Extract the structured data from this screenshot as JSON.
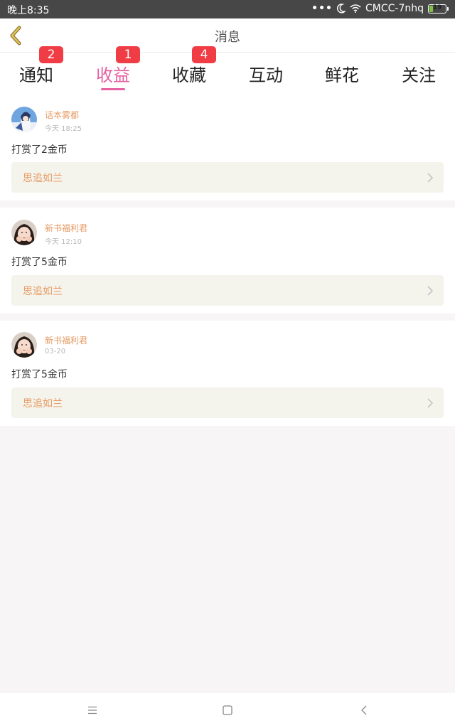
{
  "status_bar": {
    "time": "晚上8:35",
    "dots": "•••",
    "carrier": "CMCC-7nhq",
    "battery_level": "19",
    "battery_fraction": 0.19
  },
  "header": {
    "title": "消息",
    "back_icon": "chevron-left-icon",
    "back_color": "#c9a43a"
  },
  "tabs": [
    {
      "label": "通知",
      "badge": "2",
      "active": false
    },
    {
      "label": "收益",
      "badge": "1",
      "active": true
    },
    {
      "label": "收藏",
      "badge": "4",
      "active": false
    },
    {
      "label": "互动",
      "badge": "",
      "active": false
    },
    {
      "label": "鲜花",
      "badge": "",
      "active": false
    },
    {
      "label": "关注",
      "badge": "",
      "active": false
    }
  ],
  "colors": {
    "accent": "#e660a1",
    "badge": "#f03c45",
    "name": "#e59b66",
    "book_bg": "#f5f4ec"
  },
  "messages": [
    {
      "user": "话本雾都",
      "time": "今天 18:25",
      "text": "打赏了2金币",
      "book": "思追如兰",
      "avatar": "anime-avatar"
    },
    {
      "user": "新书福利君",
      "time": "今天 12:10",
      "text": "打赏了5金币",
      "book": "思追如兰",
      "avatar": "girl-avatar"
    },
    {
      "user": "新书福利君",
      "time": "03-20",
      "text": "打赏了5金币",
      "book": "思追如兰",
      "avatar": "girl-avatar"
    }
  ],
  "system_nav": {
    "menu_icon": "menu-icon",
    "home_icon": "square-home-icon",
    "back_icon": "triangle-back-icon"
  }
}
